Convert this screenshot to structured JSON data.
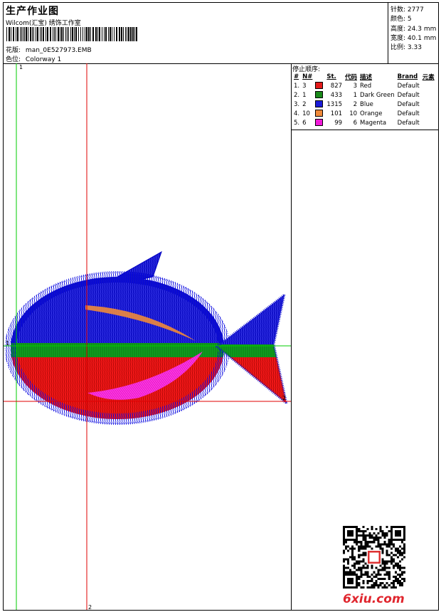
{
  "header": {
    "title": "生产作业图",
    "studio": "Wilcom(汇宝) 绣饰工作室",
    "design_label": "花版:",
    "design_value": "man_0E527973.EMB",
    "colorway_label": "色位:",
    "colorway_value": "Colorway 1"
  },
  "stats": [
    {
      "label": "针数:",
      "value": "2777"
    },
    {
      "label": "颜色:",
      "value": "5"
    },
    {
      "label": "高度:",
      "value": "24.3 mm"
    },
    {
      "label": "宽度:",
      "value": "40.1 mm"
    },
    {
      "label": "比例:",
      "value": "3.33"
    }
  ],
  "stop_sequence": {
    "title": "停止顺序:",
    "columns": [
      "#",
      "N#",
      "St.",
      "代码",
      "描述",
      "Brand",
      "元素"
    ],
    "rows": [
      {
        "num": "1.",
        "n": "3",
        "color": "#e41b1b",
        "st": "827",
        "code": "3",
        "desc": "Red",
        "brand": "Default"
      },
      {
        "num": "2.",
        "n": "1",
        "color": "#1a8a1a",
        "st": "433",
        "code": "1",
        "desc": "Dark Green",
        "brand": "Default"
      },
      {
        "num": "3.",
        "n": "2",
        "color": "#1b1bd8",
        "st": "1315",
        "code": "2",
        "desc": "Blue",
        "brand": "Default"
      },
      {
        "num": "4.",
        "n": "10",
        "color": "#f08a3a",
        "st": "101",
        "code": "10",
        "desc": "Orange",
        "brand": "Default"
      },
      {
        "num": "5.",
        "n": "6",
        "color": "#f01ad8",
        "st": "99",
        "code": "6",
        "desc": "Magenta",
        "brand": "Default"
      }
    ]
  },
  "axes": {
    "v1": "1",
    "v2": "2",
    "h1": "1",
    "h2": "2"
  },
  "logo": "6xiu.com"
}
